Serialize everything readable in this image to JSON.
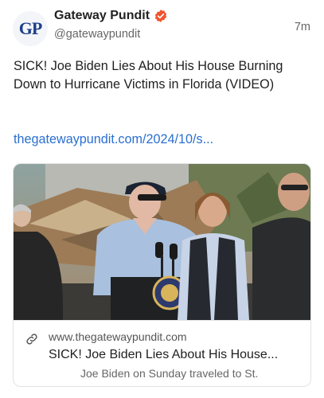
{
  "post": {
    "avatar_text": "GP",
    "author_name": "Gateway Pundit",
    "handle": "@gatewaypundit",
    "time": "7m",
    "text": "SICK! Joe Biden Lies About His House Burning Down to Hurricane Victims in Florida (VIDEO)",
    "link": "thegatewaypundit.com/2024/10/s..."
  },
  "card": {
    "domain": "www.thegatewaypundit.com",
    "title": "SICK! Joe Biden Lies About His House...",
    "description": "Joe Biden on Sunday traveled to St."
  },
  "colors": {
    "link": "#2a6fd1",
    "verified_badge": "#f2542d",
    "brand_blue": "#1d3f8a"
  },
  "icons": {
    "verified": "verified-badge-icon",
    "link": "link-chain-icon"
  }
}
